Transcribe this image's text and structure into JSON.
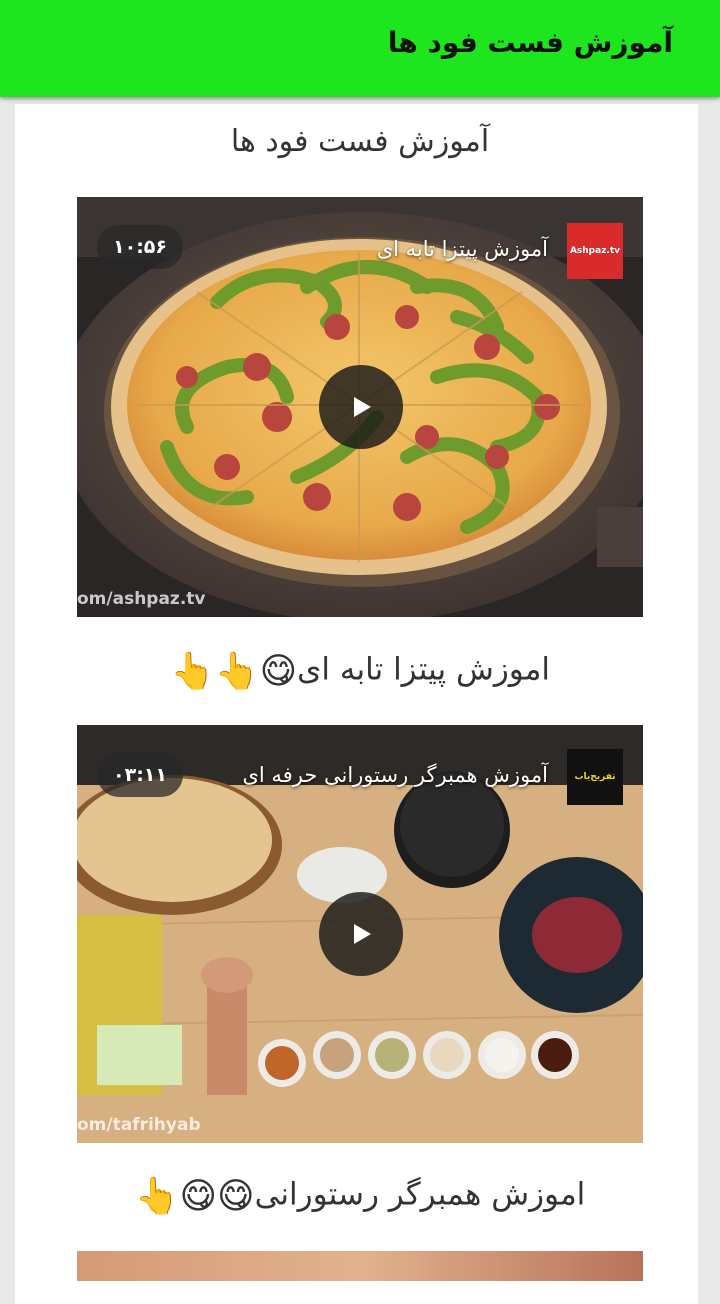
{
  "appbar": {
    "title": "آموزش فست فود ها"
  },
  "page": {
    "heading": "آموزش فست فود ها"
  },
  "videos": [
    {
      "title": "آموزش پیتزا تابه ای",
      "duration": "۱۰:۵۶",
      "channel_logo_text": "Ashpaz.tv",
      "watermark": "om/ashpaz.tv",
      "caption": "اموزش پیتزا تابه ای",
      "caption_emojis": "😋👆👆"
    },
    {
      "title": "آموزش همبرگر رستورانی حرفه ای",
      "duration": "۰۳:۱۱",
      "channel_logo_text": "تفریح‌یاب",
      "watermark": "om/tafrihyab",
      "caption": "اموزش همبرگر رستورانی",
      "caption_emojis": "😋😋👆"
    }
  ],
  "colors": {
    "appbar": "#1ee61e",
    "background": "#e9e9e9",
    "card": "#ffffff"
  },
  "icons": [
    "play-icon",
    "channel-logo",
    "duration-badge"
  ]
}
